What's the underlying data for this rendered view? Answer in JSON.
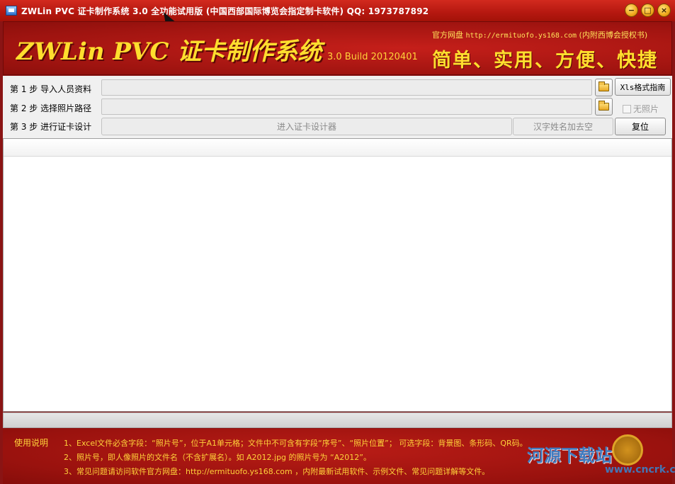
{
  "window": {
    "title": "ZWLin PVC 证卡制作系统 3.0 全功能试用版 (中国西部国际博览会指定制卡软件) QQ: 1973787892",
    "buttons": {
      "minimize": "−",
      "maximize": "□",
      "close": "×"
    }
  },
  "banner": {
    "title": "ZWLin PVC 证卡制作系统",
    "version": "3.0 Build 20120401",
    "website_label": "官方网盘",
    "website_url": "http://ermituofo.ys168.com",
    "website_note": "(内附西博会授权书)",
    "slogan": "简单、实用、方便、快捷"
  },
  "steps": [
    {
      "label": "第 1 步  导入人员资料",
      "value": ""
    },
    {
      "label": "第 2 步  选择照片路径",
      "value": ""
    },
    {
      "label": "第 3 步  进行证卡设计"
    }
  ],
  "buttons": {
    "xls_guide": "Xls格式指南",
    "enter_designer": "进入证卡设计器",
    "add_space": "汉字姓名加去空",
    "reset": "复位"
  },
  "checkbox": {
    "no_photo": "无照片",
    "checked": false
  },
  "footer": {
    "label": "使用说明",
    "line1": "1、Excel文件必含字段：“照片号”，位于A1单元格；文件中不可含有字段“序号”、“照片位置”；  可选字段：背景图、条形码、QR码。",
    "line2": "2、照片号，即人像照片的文件名（不含扩展名）。如 A2012.jpg 的照片号为 “A2012”。",
    "line3": "3、常见问题请访问软件官方网盘：http://ermituofo.ys168.com ，内附最新试用软件、示例文件、常见问题详解等文件。"
  },
  "watermark": {
    "text": "河源下载站",
    "sub": "www.cncrk.com"
  }
}
